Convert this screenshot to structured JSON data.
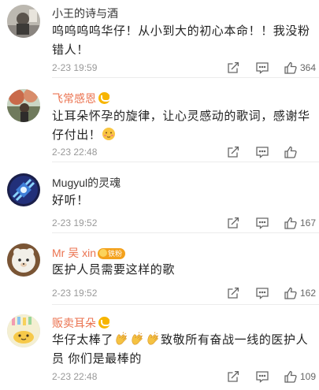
{
  "comments": [
    {
      "user": "小王的诗与酒",
      "text": "呜呜呜呜华仔！从小到大的初心本命！！我没粉错人！",
      "time": "2-23 19:59",
      "likes": "364"
    },
    {
      "user": "飞常感恩",
      "text": "让耳朵怀孕的旋律，让心灵感动的歌词，感谢华仔付出！",
      "time": "2-23 22:48",
      "likes": "",
      "emoji": "blush-emoji"
    },
    {
      "user": "Mugyul的灵魂",
      "text": "好听！",
      "time": "2-23 19:52",
      "likes": "167"
    },
    {
      "user": "Mr 吴 xin",
      "badge": "铁粉",
      "text": "医护人员需要这样的歌",
      "time": "2-23 19:52",
      "likes": "162"
    },
    {
      "user": "贩卖耳朵",
      "text_before": "华仔太棒了",
      "text_after": "致敬所有奋战一线的医护人员 你们是最棒的",
      "clap_emoji_count": 3,
      "time": "2-23 22:48",
      "likes": "109"
    }
  ],
  "icons": {
    "share": "share-icon",
    "comment": "comment-icon",
    "like": "thumbs-up-icon",
    "verified": "vip-badge-icon"
  },
  "colors": {
    "vip_name": "#eb7350",
    "normal_name": "#333333",
    "time": "#999999",
    "vip_badge": "#f7b500",
    "fan_badge": "#f3a11c"
  }
}
